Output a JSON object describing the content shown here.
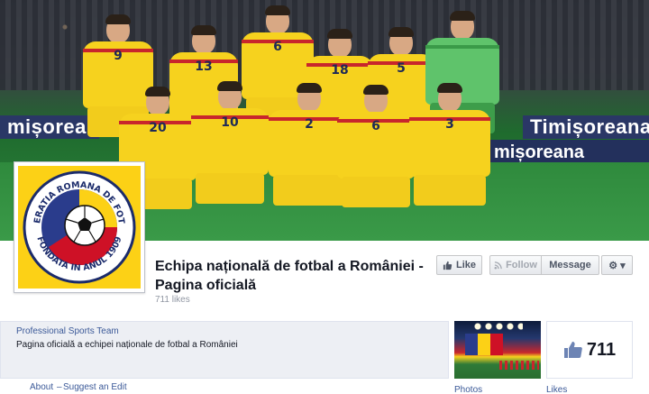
{
  "cover": {
    "ad_left": "mișoreana",
    "ad_right": "Timișoreana",
    "ad_right2": "mișoreana",
    "players_back": [
      {
        "number": "9"
      },
      {
        "number": "13"
      },
      {
        "number": "6"
      },
      {
        "number": "18"
      },
      {
        "number": "5"
      },
      {
        "number": ""
      }
    ],
    "players_front": [
      {
        "number": "20"
      },
      {
        "number": "10"
      },
      {
        "number": "2"
      },
      {
        "number": "6"
      },
      {
        "number": "3"
      }
    ]
  },
  "profile": {
    "crest_text_top": "FEDERATIA ROMANA DE FOTBAL",
    "crest_text_bottom": "FONDATA IN ANUL 1909"
  },
  "header": {
    "page_name": "Echipa națională de fotbal a României - Pagina oficială",
    "likes_text": "711 likes"
  },
  "buttons": {
    "like": "Like",
    "follow": "Follow",
    "message": "Message",
    "gear": "⚙ ▾"
  },
  "about": {
    "category": "Professional Sports Team",
    "description": "Pagina oficială a echipei naționale de fotbal a României"
  },
  "links": {
    "about": "About",
    "separator": "–",
    "suggest_edit": "Suggest an Edit"
  },
  "tiles": {
    "photos_label": "Photos",
    "likes_label": "Likes",
    "likes_count": "711"
  },
  "colors": {
    "link": "#3b5998",
    "cover_yellow": "#f6d21e",
    "romania_blue": "#2a3c8c",
    "romania_red": "#ce1126"
  }
}
